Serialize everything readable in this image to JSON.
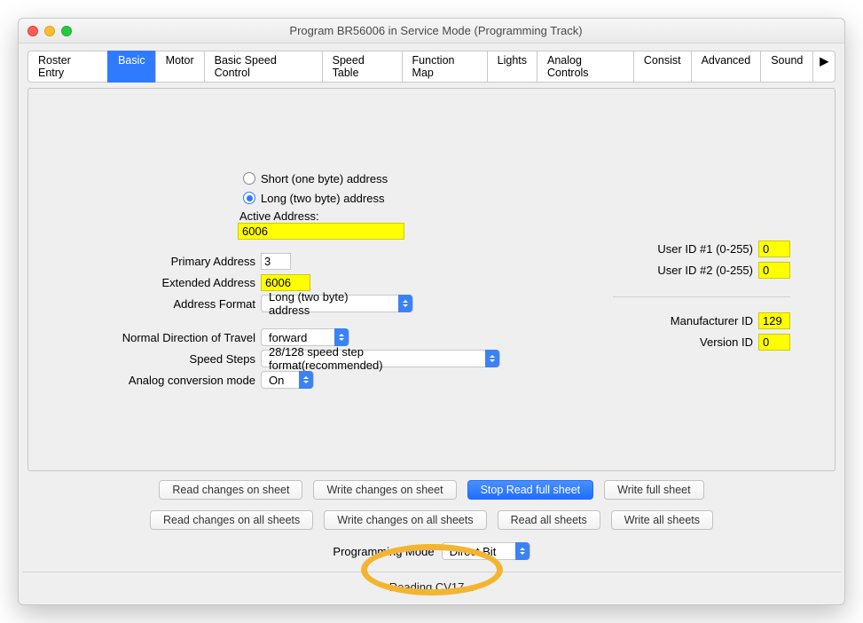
{
  "title": "Program BR56006 in Service Mode (Programming Track)",
  "tabs": [
    "Roster Entry",
    "Basic",
    "Motor",
    "Basic Speed Control",
    "Speed Table",
    "Function Map",
    "Lights",
    "Analog Controls",
    "Consist",
    "Advanced",
    "Sound"
  ],
  "active_tab": "Basic",
  "radios": {
    "short": "Short (one byte) address",
    "long": "Long (two byte) address"
  },
  "active_address_label": "Active Address:",
  "active_address_value": "6006",
  "fields": {
    "primary_address": {
      "label": "Primary Address",
      "value": "3"
    },
    "extended_address": {
      "label": "Extended Address",
      "value": "6006"
    },
    "address_format": {
      "label": "Address Format",
      "value": "Long (two byte) address"
    },
    "direction": {
      "label": "Normal Direction of Travel",
      "value": "forward"
    },
    "speed_steps": {
      "label": "Speed Steps",
      "value": "28/128 speed step format(recommended)"
    },
    "analog": {
      "label": "Analog conversion mode",
      "value": "On"
    }
  },
  "right": {
    "user1": {
      "label": "User ID #1 (0-255)",
      "value": "0"
    },
    "user2": {
      "label": "User ID #2 (0-255)",
      "value": "0"
    },
    "mfr": {
      "label": "Manufacturer ID",
      "value": "129"
    },
    "ver": {
      "label": "Version ID",
      "value": "0"
    }
  },
  "sheet_buttons": {
    "rcs": "Read changes on sheet",
    "wcs": "Write changes on sheet",
    "srfs": "Stop Read full sheet",
    "wfs": "Write full sheet"
  },
  "all_buttons": {
    "rca": "Read changes on all sheets",
    "wca": "Write changes on all sheets",
    "ras": "Read all sheets",
    "was": "Write all sheets"
  },
  "pm": {
    "label": "Programming Mode",
    "value": "Direct Bit"
  },
  "status": "Reading CV17..."
}
